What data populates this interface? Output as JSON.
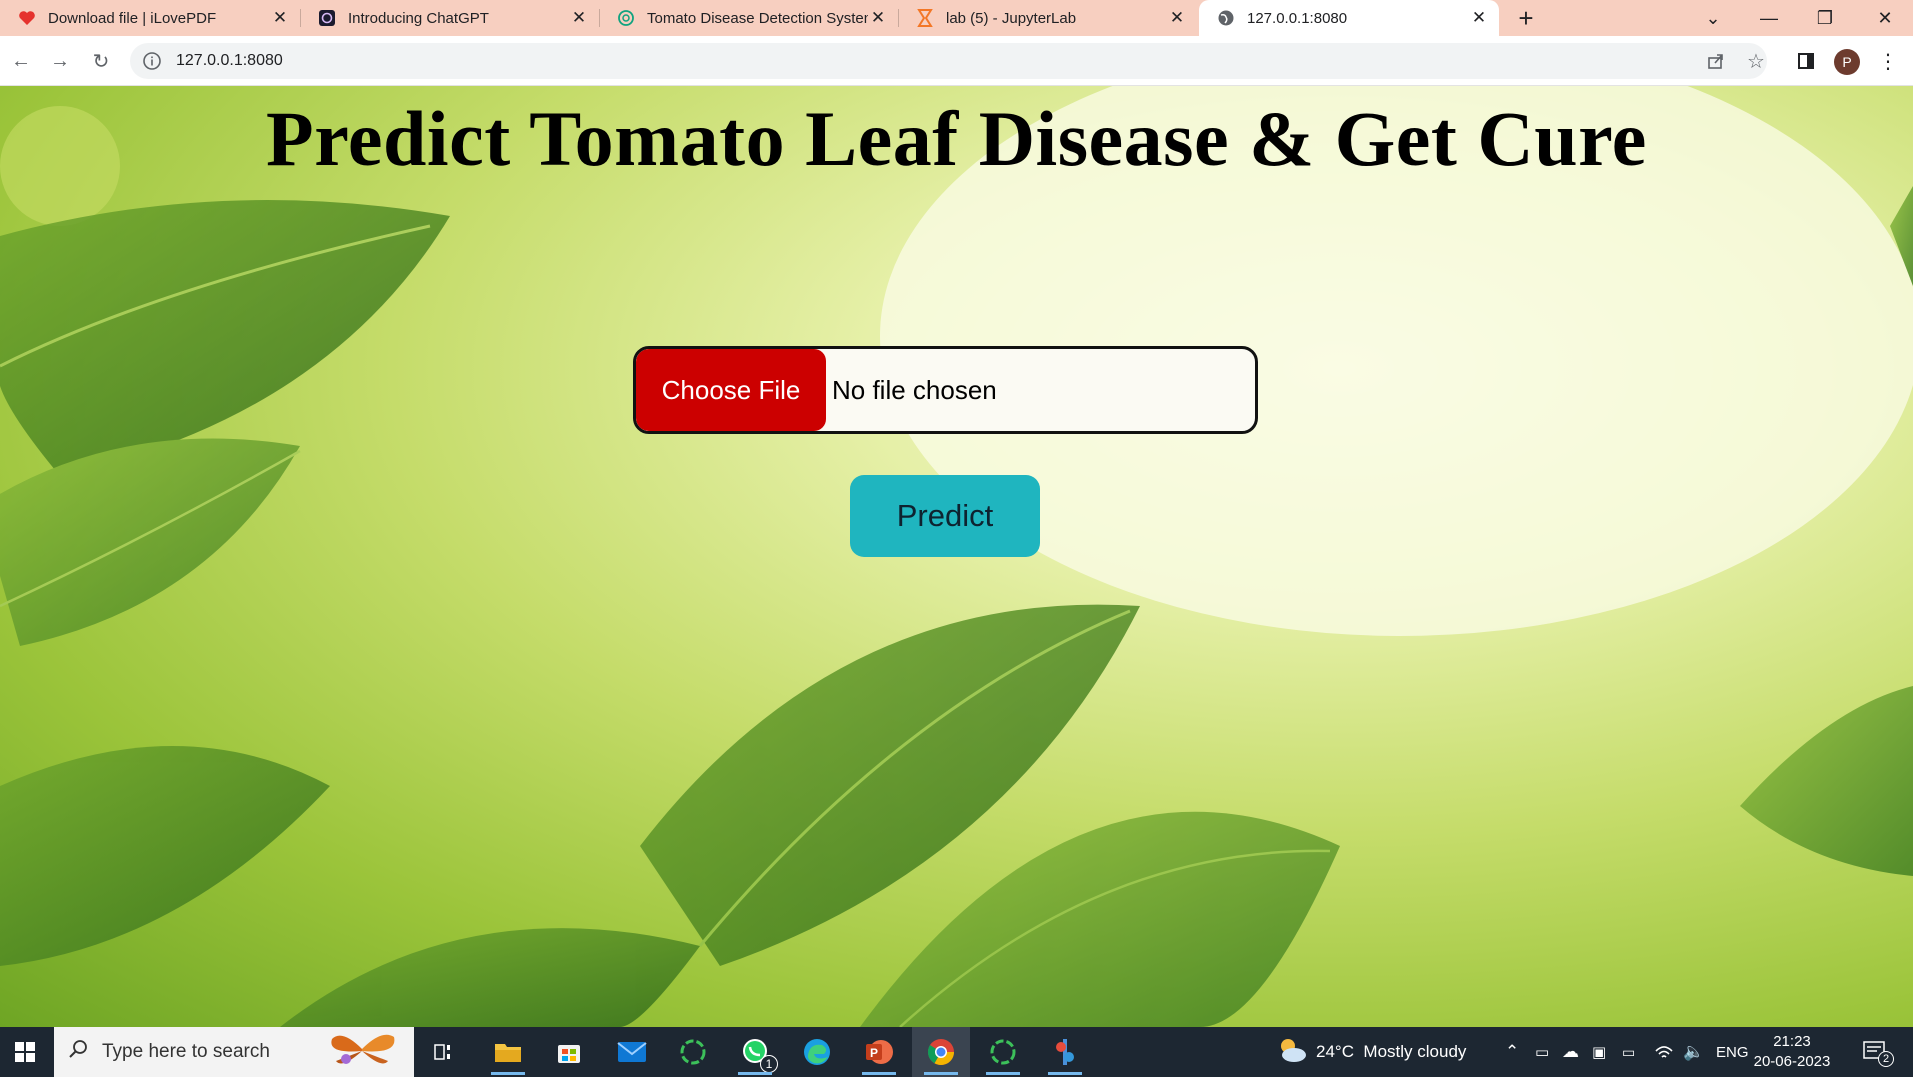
{
  "browser": {
    "tabs": [
      {
        "title": "Download file | iLovePDF",
        "icon": "ilovepdf-heart-icon",
        "active": false
      },
      {
        "title": "Introducing ChatGPT",
        "icon": "chatgpt-icon",
        "active": false
      },
      {
        "title": "Tomato Disease Detection System",
        "icon": "openai-icon",
        "active": false
      },
      {
        "title": "lab (5) - JupyterLab",
        "icon": "jupyter-hourglass-icon",
        "active": false
      },
      {
        "title": "127.0.0.1:8080",
        "icon": "globe-icon",
        "active": true
      }
    ],
    "url": "127.0.0.1:8080",
    "profile_initial": "P",
    "colors": {
      "tabstrip": "#f7cfc0",
      "active_tab": "#ffffff"
    }
  },
  "page": {
    "heading": "Predict Tomato Leaf Disease & Get Cure",
    "file_button_label": "Choose File",
    "file_status": "No file chosen",
    "predict_label": "Predict",
    "colors": {
      "choose_file": "#cc0000",
      "predict": "#1fb5bf"
    }
  },
  "taskbar": {
    "search_placeholder": "Type here to search",
    "weather": "24°C  Mostly cloudy",
    "language": "ENG",
    "time": "21:23",
    "date": "20-06-2023",
    "notification_count": "2",
    "whatsapp_badge": "1",
    "apps": [
      "task-view",
      "file-explorer",
      "microsoft-store",
      "mail",
      "circle-app",
      "whatsapp",
      "edge",
      "powerpoint",
      "chrome",
      "circle-app-2",
      "python-app"
    ]
  }
}
